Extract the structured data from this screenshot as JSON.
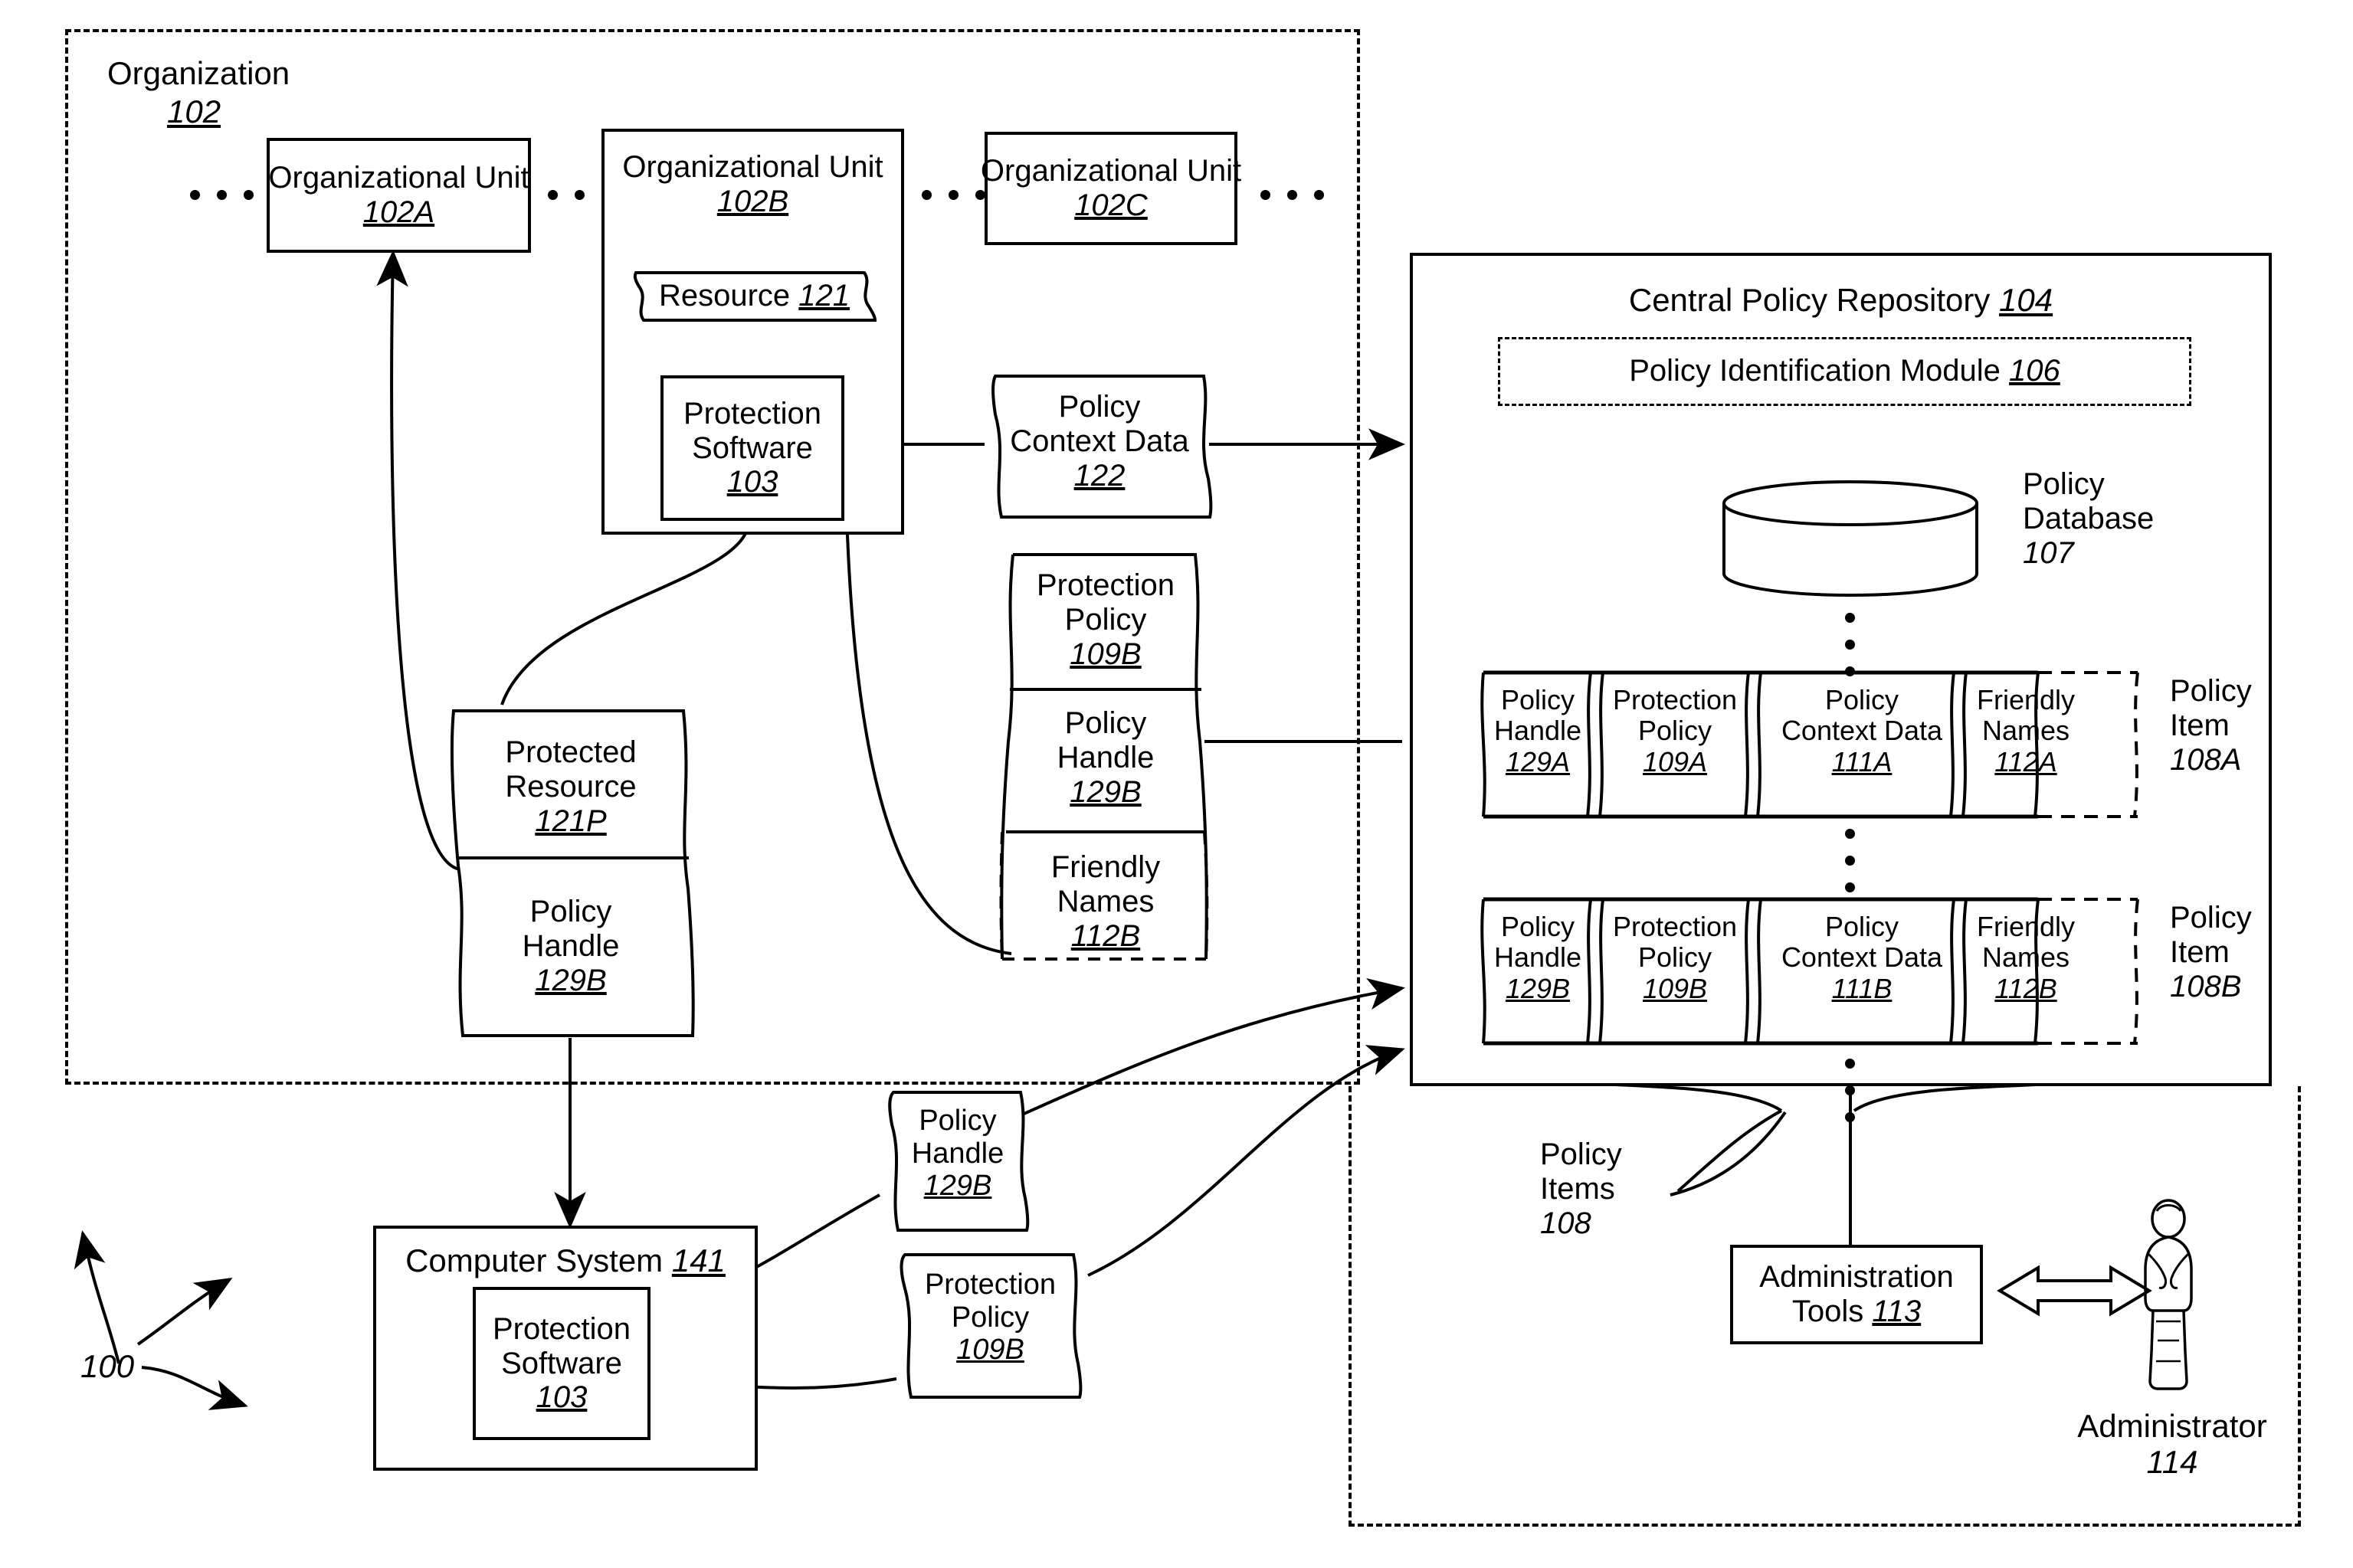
{
  "figure": {
    "number": "100"
  },
  "organization": {
    "label": "Organization",
    "ref": "102",
    "units": [
      {
        "name": "Organizational Unit",
        "ref": "102A"
      },
      {
        "name": "Organizational Unit",
        "ref": "102B"
      },
      {
        "name": "Organizational Unit",
        "ref": "102C"
      }
    ],
    "resource": {
      "label": "Resource",
      "ref": "121"
    },
    "protection_software": {
      "line1": "Protection",
      "line2": "Software",
      "ref": "103"
    },
    "protected_resource": {
      "line1": "Protected",
      "line2": "Resource",
      "ref": "121P"
    },
    "protected_resource_handle": {
      "line1": "Policy",
      "line2": "Handle",
      "ref": "129B"
    }
  },
  "banners": {
    "policy_context_data": {
      "line1": "Policy",
      "line2": "Context Data",
      "ref": "122"
    },
    "protection_policy_b": {
      "line1": "Protection",
      "line2": "Policy",
      "ref": "109B"
    },
    "policy_handle_b": {
      "line1": "Policy",
      "line2": "Handle",
      "ref": "129B"
    },
    "friendly_names_b": {
      "line1": "Friendly",
      "line2": "Names",
      "ref": "112B"
    },
    "policy_handle_bottom": {
      "line1": "Policy",
      "line2": "Handle",
      "ref": "129B"
    },
    "protection_policy_bottom": {
      "line1": "Protection",
      "line2": "Policy",
      "ref": "109B"
    }
  },
  "computer_system": {
    "label": "Computer System",
    "ref": "141",
    "protection_software": {
      "line1": "Protection",
      "line2": "Software",
      "ref": "103"
    }
  },
  "repository": {
    "title": "Central Policy Repository",
    "ref": "104",
    "policy_identification_module": {
      "label": "Policy Identification Module",
      "ref": "106"
    },
    "policy_database": {
      "line1": "Policy",
      "line2": "Database",
      "ref": "107"
    },
    "policy_items_label": {
      "line1": "Policy",
      "line2": "Items",
      "ref": "108"
    },
    "items": [
      {
        "item_label": {
          "line1": "Policy",
          "line2": "Item",
          "ref": "108A"
        },
        "fields": [
          {
            "line1": "Policy",
            "line2": "Handle",
            "ref": "129A"
          },
          {
            "line1": "Protection",
            "line2": "Policy",
            "ref": "109A"
          },
          {
            "line1": "Policy",
            "line2": "Context Data",
            "ref": "111A"
          },
          {
            "line1": "Friendly",
            "line2": "Names",
            "ref": "112A"
          }
        ]
      },
      {
        "item_label": {
          "line1": "Policy",
          "line2": "Item",
          "ref": "108B"
        },
        "fields": [
          {
            "line1": "Policy",
            "line2": "Handle",
            "ref": "129B"
          },
          {
            "line1": "Protection",
            "line2": "Policy",
            "ref": "109B"
          },
          {
            "line1": "Policy",
            "line2": "Context Data",
            "ref": "111B"
          },
          {
            "line1": "Friendly",
            "line2": "Names",
            "ref": "112B"
          }
        ]
      }
    ],
    "administration_tools": {
      "line1": "Administration",
      "line2": "Tools",
      "ref": "113"
    },
    "administrator": {
      "label": "Administrator",
      "ref": "114"
    }
  }
}
